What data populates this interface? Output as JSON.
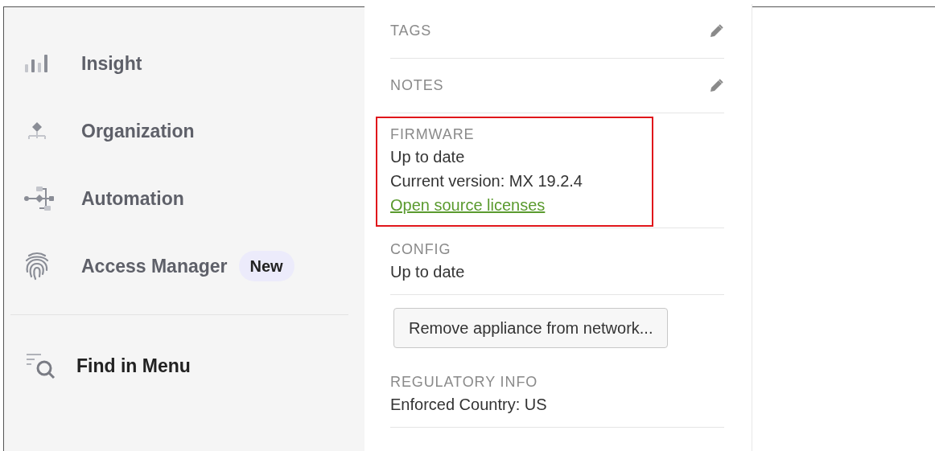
{
  "sidebar": {
    "items": [
      {
        "kind": "bars",
        "label": "Insight"
      },
      {
        "kind": "org",
        "label": "Organization"
      },
      {
        "kind": "flow",
        "label": "Automation"
      },
      {
        "kind": "fingerprint",
        "label": "Access Manager",
        "badge": "New"
      }
    ],
    "find": {
      "label": "Find in Menu"
    }
  },
  "details": {
    "sections": [
      {
        "kind": "editable",
        "label": "TAGS"
      },
      {
        "kind": "editable",
        "label": "NOTES"
      },
      {
        "kind": "info",
        "label": "FIRMWARE",
        "lines": [
          "Up to date",
          "Current version: MX 19.2.4"
        ],
        "link": "Open source licenses",
        "highlighted": true
      },
      {
        "kind": "info",
        "label": "CONFIG",
        "lines": [
          "Up to date"
        ]
      },
      {
        "kind": "button",
        "label": "Remove appliance from network..."
      },
      {
        "kind": "info",
        "label": "REGULATORY INFO",
        "lines": [
          "Enforced Country: US"
        ]
      }
    ]
  }
}
